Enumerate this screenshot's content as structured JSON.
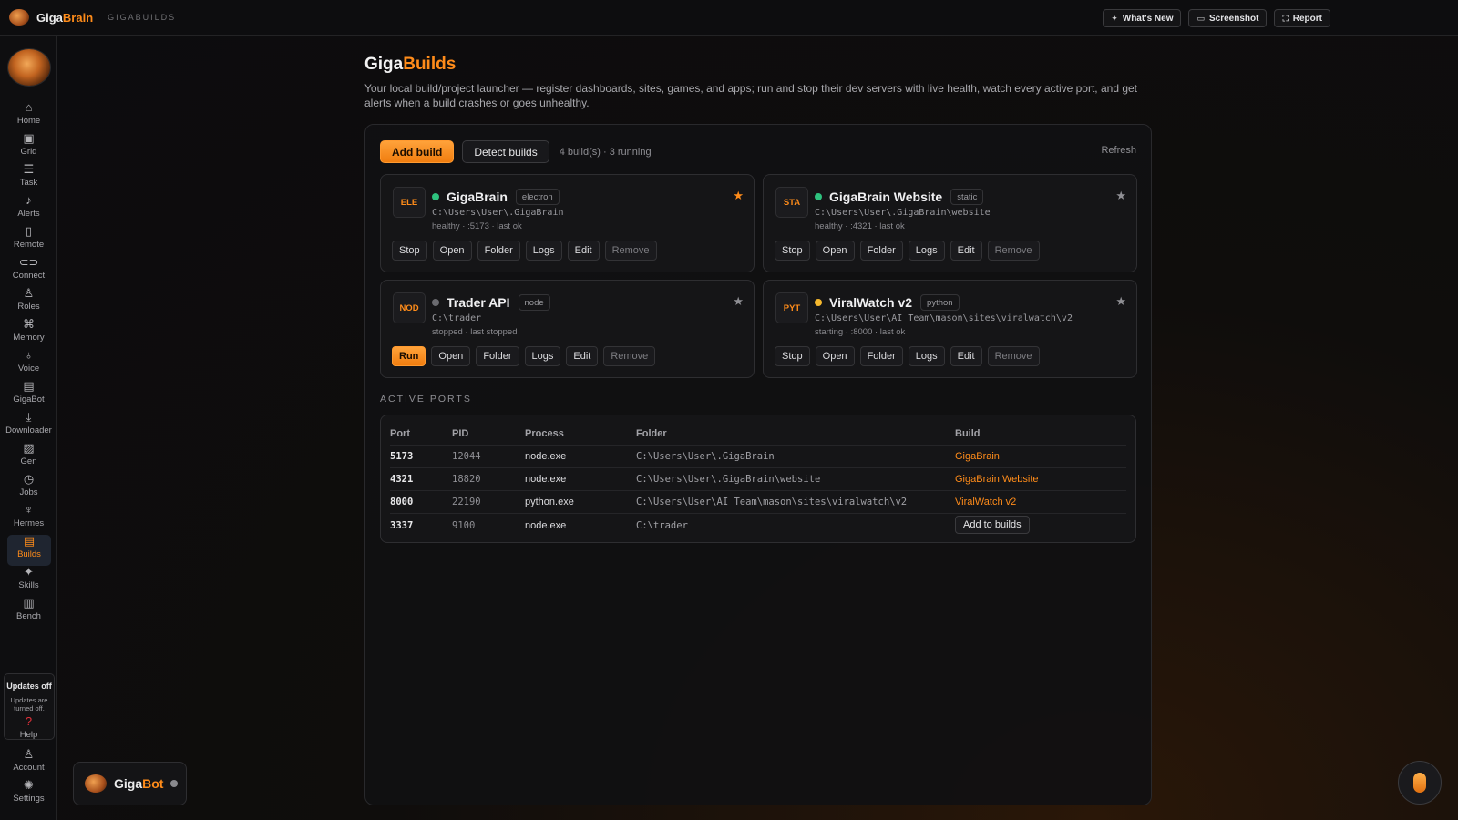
{
  "topbar": {
    "brand_prefix": "Giga",
    "brand_suffix": "Brain",
    "section": "GIGABUILDS",
    "whats_new": "What's New",
    "screenshot": "Screenshot",
    "report": "Report"
  },
  "sidebar": {
    "items": [
      {
        "label": "Home",
        "icon": "home-icon"
      },
      {
        "label": "Grid",
        "icon": "grid-icon"
      },
      {
        "label": "Task",
        "icon": "task-icon"
      },
      {
        "label": "Alerts",
        "icon": "bell-icon"
      },
      {
        "label": "Remote",
        "icon": "phone-icon"
      },
      {
        "label": "Connect",
        "icon": "link-icon"
      },
      {
        "label": "Roles",
        "icon": "roles-icon"
      },
      {
        "label": "Memory",
        "icon": "memory-icon"
      },
      {
        "label": "Voice",
        "icon": "mic-icon"
      },
      {
        "label": "GigaBot",
        "icon": "bot-icon"
      },
      {
        "label": "Downloader",
        "icon": "download-icon"
      },
      {
        "label": "Gen",
        "icon": "image-icon"
      },
      {
        "label": "Jobs",
        "icon": "clock-icon"
      },
      {
        "label": "Hermes",
        "icon": "hermes-icon"
      },
      {
        "label": "Builds",
        "icon": "builds-icon"
      },
      {
        "label": "Skills",
        "icon": "sparkle-icon"
      },
      {
        "label": "Bench",
        "icon": "bench-icon"
      }
    ],
    "active": "Builds",
    "updates_title": "Updates off",
    "updates_desc": "Updates are turned off.",
    "bottom": [
      {
        "label": "Help",
        "icon": "help-icon"
      },
      {
        "label": "Account",
        "icon": "account-icon"
      },
      {
        "label": "Settings",
        "icon": "gear-icon"
      }
    ]
  },
  "gigabot": {
    "prefix": "Giga",
    "suffix": "Bot"
  },
  "page": {
    "title_prefix": "Giga",
    "title_suffix": "Builds",
    "description": "Your local build/project launcher — register dashboards, sites, games, and apps; run and stop their dev servers with live health, watch every active port, and get alerts when a build crashes or goes unhealthy."
  },
  "toolbar": {
    "add_build": "Add build",
    "detect_builds": "Detect builds",
    "count": "4 build(s) · 3 running",
    "refresh": "Refresh"
  },
  "builds": [
    {
      "badge": "ELE",
      "name": "GigaBrain",
      "type": "electron",
      "path": "C:\\Users\\User\\.GigaBrain",
      "health": "healthy · :5173 · last ok",
      "status_color": "#2ec27e",
      "favorite": true,
      "primary": "Stop"
    },
    {
      "badge": "STA",
      "name": "GigaBrain Website",
      "type": "static",
      "path": "C:\\Users\\User\\.GigaBrain\\website",
      "health": "healthy · :4321 · last ok",
      "status_color": "#2ec27e",
      "favorite": false,
      "primary": "Stop"
    },
    {
      "badge": "NOD",
      "name": "Trader API",
      "type": "node",
      "path": "C:\\trader",
      "health": "stopped · last stopped",
      "status_color": "#6b6b70",
      "favorite": false,
      "primary": "Run"
    },
    {
      "badge": "PYT",
      "name": "ViralWatch v2",
      "type": "python",
      "path": "C:\\Users\\User\\AI Team\\mason\\sites\\viralwatch\\v2",
      "health": "starting · :8000 · last ok",
      "status_color": "#f5b82e",
      "favorite": false,
      "primary": "Stop"
    }
  ],
  "card_actions": {
    "open": "Open",
    "folder": "Folder",
    "logs": "Logs",
    "edit": "Edit",
    "remove": "Remove"
  },
  "ports": {
    "label": "ACTIVE PORTS",
    "headers": {
      "port": "Port",
      "pid": "PID",
      "process": "Process",
      "folder": "Folder",
      "build": "Build"
    },
    "rows": [
      {
        "port": "5173",
        "pid": "12044",
        "process": "node.exe",
        "folder": "C:\\Users\\User\\.GigaBrain",
        "build": "GigaBrain"
      },
      {
        "port": "4321",
        "pid": "18820",
        "process": "node.exe",
        "folder": "C:\\Users\\User\\.GigaBrain\\website",
        "build": "GigaBrain Website"
      },
      {
        "port": "8000",
        "pid": "22190",
        "process": "python.exe",
        "folder": "C:\\Users\\User\\AI Team\\mason\\sites\\viralwatch\\v2",
        "build": "ViralWatch v2"
      },
      {
        "port": "3337",
        "pid": "9100",
        "process": "node.exe",
        "folder": "C:\\trader",
        "build": ""
      }
    ],
    "add_to_builds": "Add to builds"
  }
}
